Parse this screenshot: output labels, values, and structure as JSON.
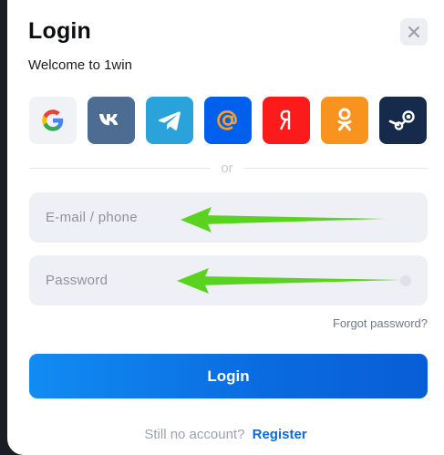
{
  "header": {
    "title": "Login",
    "subtitle": "Welcome to 1win"
  },
  "social_providers": [
    {
      "name": "Google",
      "icon": "google-icon",
      "bg": "#f1f2f5"
    },
    {
      "name": "VK",
      "icon": "vk-icon",
      "bg": "#4c6c91"
    },
    {
      "name": "Telegram",
      "icon": "telegram-icon",
      "bg": "#2aa2da"
    },
    {
      "name": "Mail.ru",
      "icon": "mail-at-icon",
      "bg": "#0060ee"
    },
    {
      "name": "Yandex",
      "icon": "yandex-icon",
      "bg": "#fc1b1b"
    },
    {
      "name": "Odnoklassniki",
      "icon": "ok-icon",
      "bg": "#f7931e"
    },
    {
      "name": "Steam",
      "icon": "steam-icon",
      "bg": "#162b4c"
    }
  ],
  "divider_text": "or",
  "form": {
    "email_placeholder": "E-mail / phone",
    "password_placeholder": "Password",
    "forgot_label": "Forgot password?",
    "submit_label": "Login"
  },
  "footer": {
    "question": "Still no account?",
    "register_label": "Register"
  },
  "colors": {
    "accent": "#0b6ad8",
    "annotation_arrow": "#59d320"
  }
}
